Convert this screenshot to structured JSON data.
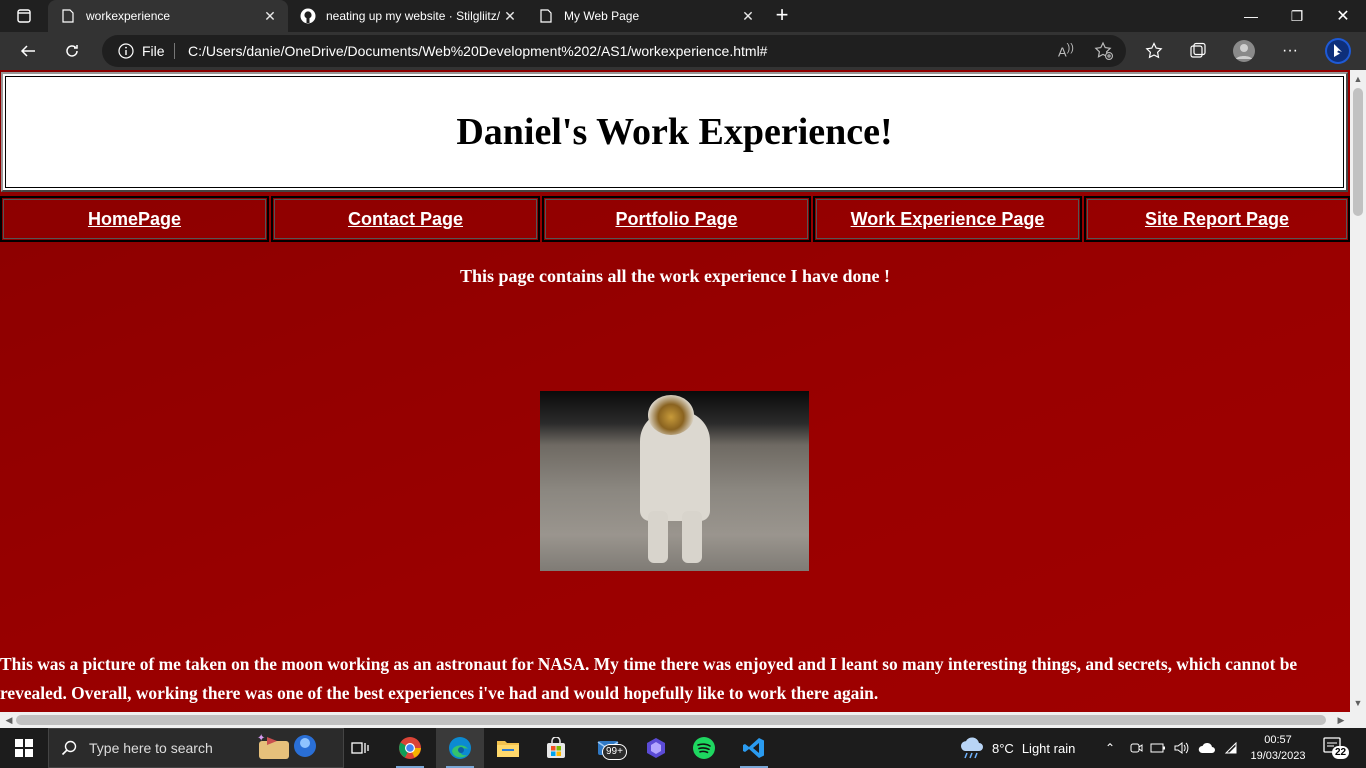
{
  "browser": {
    "tabs": [
      {
        "title": "workexperience",
        "active": true,
        "favicon": "page-icon"
      },
      {
        "title": "neating up my website · Stilgliitz/",
        "active": false,
        "favicon": "github-icon"
      },
      {
        "title": "My Web Page",
        "active": false,
        "favicon": "page-icon"
      }
    ],
    "address": {
      "scheme_label": "File",
      "url": "C:/Users/danie/OneDrive/Documents/Web%20Development%202/AS1/workexperience.html#"
    }
  },
  "page": {
    "title": "Daniel's Work Experience!",
    "nav": [
      {
        "label": "HomePage"
      },
      {
        "label": "Contact Page"
      },
      {
        "label": "Portfolio Page"
      },
      {
        "label": "Work Experience Page"
      },
      {
        "label": "Site Report Page"
      }
    ],
    "intro": "This page contains all the work experience I have done !",
    "image_alt": "astronaut on the moon",
    "paragraph": "This was a picture of me taken on the moon working as an astronaut for NASA. My time there was enjoyed and I leant so many interesting things, and secrets, which cannot be revealed. Overall, working there was one of the best experiences i've had and would hopefully like to work there again.",
    "background_color": "#990000"
  },
  "taskbar": {
    "search_placeholder": "Type here to search",
    "mail_badge": "99+",
    "weather_temp": "8°C",
    "weather_desc": "Light rain",
    "time": "00:57",
    "date": "19/03/2023",
    "notification_count": "22"
  }
}
